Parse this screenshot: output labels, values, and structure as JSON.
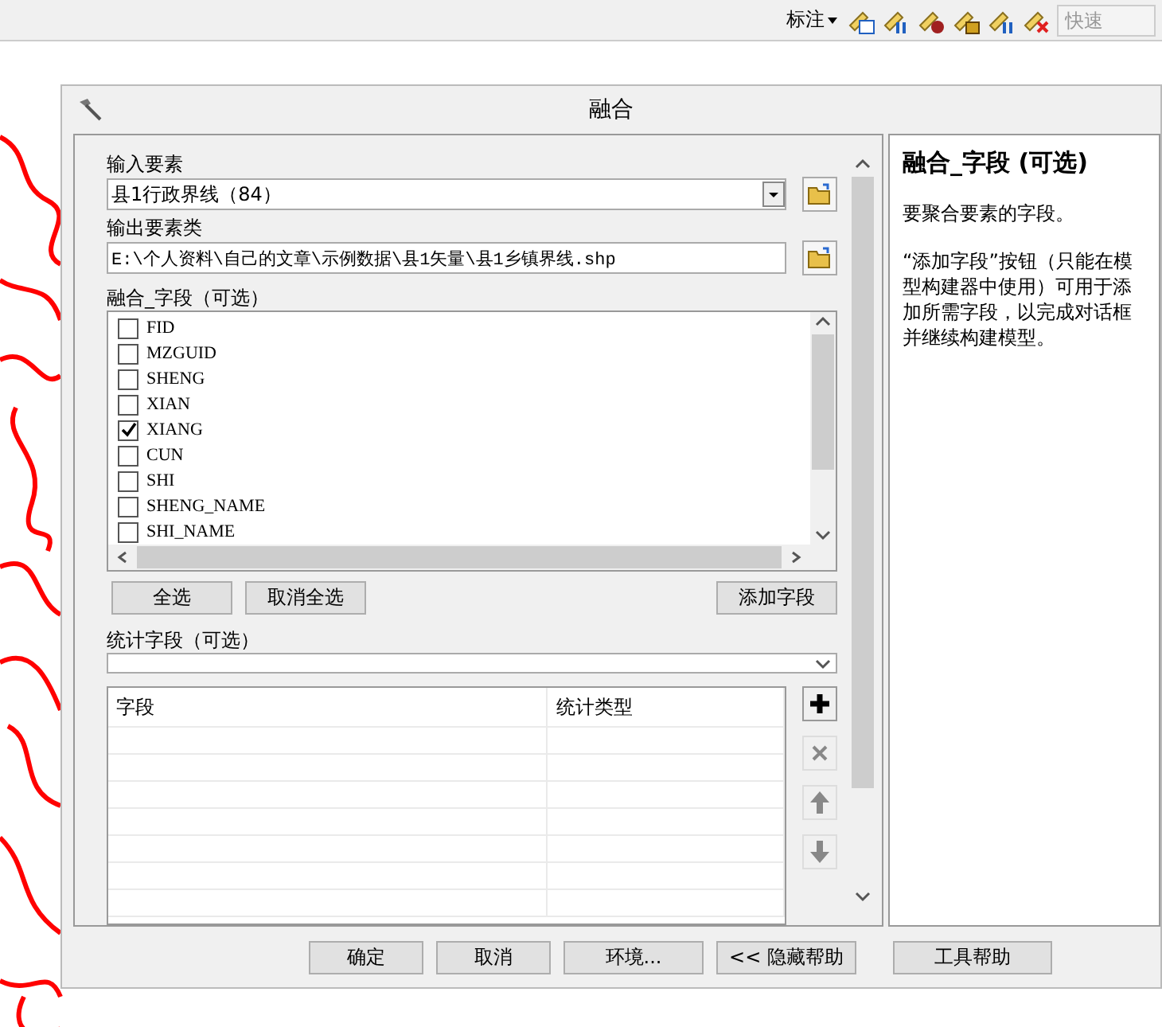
{
  "toolbar": {
    "menu_label": "标注",
    "quick_search": {
      "placeholder": "快速"
    }
  },
  "dialog": {
    "title": "融合",
    "input_features": {
      "label": "输入要素",
      "value": "县1行政界线（84）"
    },
    "output_features": {
      "label": "输出要素类",
      "value": "E:\\个人资料\\自己的文章\\示例数据\\县1矢量\\县1乡镇界线.shp"
    },
    "dissolve_fields": {
      "label": "融合_字段（可选）",
      "items": [
        {
          "name": "FID",
          "checked": false
        },
        {
          "name": "MZGUID",
          "checked": false
        },
        {
          "name": "SHENG",
          "checked": false
        },
        {
          "name": "XIAN",
          "checked": false
        },
        {
          "name": "XIANG",
          "checked": true
        },
        {
          "name": "CUN",
          "checked": false
        },
        {
          "name": "SHI",
          "checked": false
        },
        {
          "name": "SHENG_NAME",
          "checked": false
        },
        {
          "name": "SHI_NAME",
          "checked": false
        }
      ]
    },
    "list_buttons": [
      "全选",
      "取消全选",
      "添加字段"
    ],
    "statistics_fields": {
      "label": "统计字段（可选）",
      "table": {
        "columns": [
          "字段",
          "统计类型"
        ]
      }
    },
    "action_buttons": [
      "确定",
      "取消",
      "环境...",
      "<< 隐藏帮助",
      "工具帮助"
    ],
    "help": {
      "title": "融合_字段 (可选)",
      "paragraphs": [
        "要聚合要素的字段。",
        "“添加字段”按钮（只能在模型构建器中使用）可用于添加所需字段，以完成对话框并继续构建模型。"
      ]
    }
  }
}
